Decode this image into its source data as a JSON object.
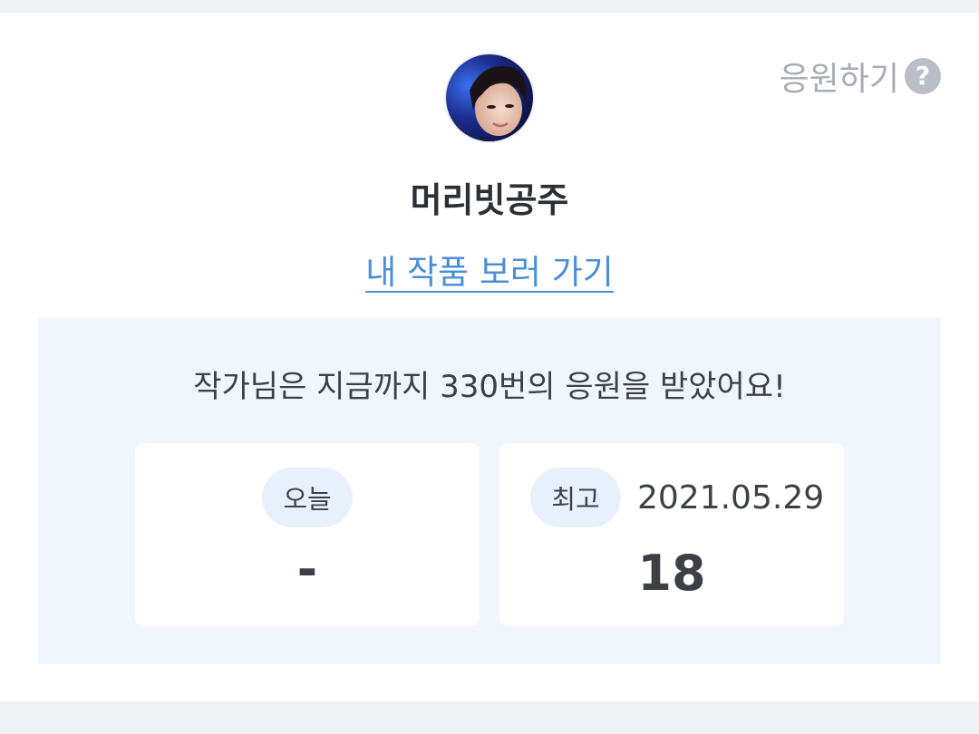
{
  "support": {
    "label": "응원하기",
    "help_glyph": "?"
  },
  "author": {
    "name": "머리빗공주",
    "works_link": "내 작품 보러 가기"
  },
  "stats": {
    "headline": "작가님은 지금까지 330번의 응원을 받았어요!",
    "today": {
      "label": "오늘",
      "value": "-"
    },
    "best": {
      "label": "최고",
      "date": "2021.05.29",
      "value": "18"
    }
  },
  "colors": {
    "link": "#4b8fd6",
    "panel": "#f1f6fc",
    "pill": "#e8f1fb"
  }
}
